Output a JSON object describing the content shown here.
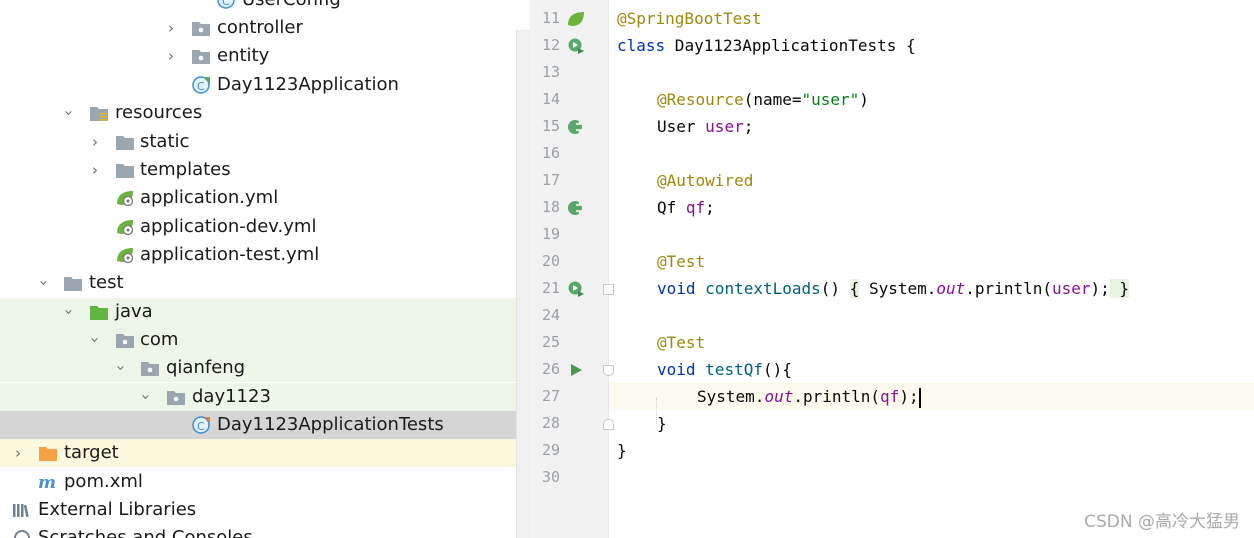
{
  "project_tree": {
    "top_partial": "UserConfig",
    "controller": "controller",
    "entity": "entity",
    "main_app": "Day1123Application",
    "resources": "resources",
    "static": "static",
    "templates": "templates",
    "app_yml": "application.yml",
    "app_dev_yml": "application-dev.yml",
    "app_test_yml": "application-test.yml",
    "test": "test",
    "java": "java",
    "com": "com",
    "qianfeng": "qianfeng",
    "day1123": "day1123",
    "test_class": "Day1123ApplicationTests",
    "target": "target",
    "pom": "pom.xml",
    "external_libraries": "External Libraries",
    "scratches": "Scratches and Consoles"
  },
  "editor": {
    "line_numbers": [
      "11",
      "12",
      "13",
      "14",
      "15",
      "16",
      "17",
      "18",
      "19",
      "20",
      "21",
      "24",
      "25",
      "26",
      "27",
      "28",
      "29",
      "30"
    ],
    "l11_ann": "@SpringBootTest",
    "l12_kw": "class",
    "l12_rest": " Day1123ApplicationTests {",
    "l14_ann": "@Resource",
    "l14_open": "(name=",
    "l14_str": "\"user\"",
    "l14_close": ")",
    "l15_type": "User ",
    "l15_field": "user",
    "l15_semi": ";",
    "l17_ann": "@Autowired",
    "l18_type": "Qf ",
    "l18_field": "qf",
    "l18_semi": ";",
    "l20_ann": "@Test",
    "l21_kw": "void",
    "l21_fn": "contextLoads",
    "l21_paren": "() ",
    "l21_ob": "{",
    "l21_sys": " System.",
    "l21_out": "out",
    "l21_print": ".println(",
    "l21_arg": "user",
    "l21_end": ");",
    "l21_cb": " }",
    "l25_ann": "@Test",
    "l26_kw": "void",
    "l26_fn": "testQf",
    "l26_rest": "(){",
    "l27_sys": "System.",
    "l27_out": "out",
    "l27_print": ".println(",
    "l27_arg": "qf",
    "l27_end": ");",
    "l28": "}",
    "l29": "}"
  },
  "watermark": "CSDN @高冷大猛男"
}
